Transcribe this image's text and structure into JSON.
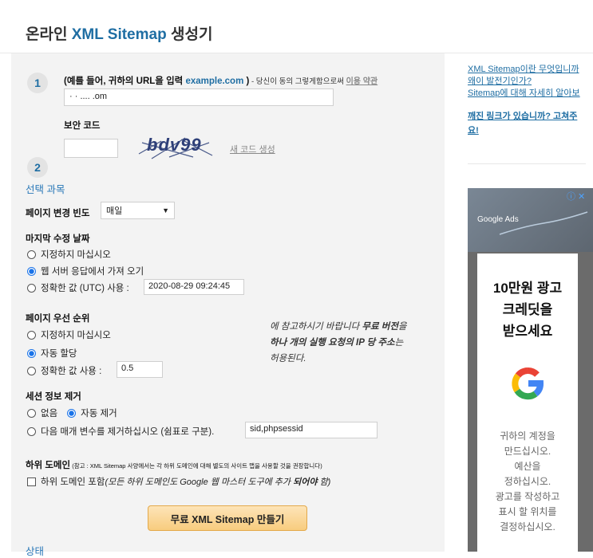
{
  "header": {
    "title_pre": "온라인 ",
    "title_accent": "XML Sitemap",
    "title_post": " 생성기"
  },
  "step1": {
    "number": "1",
    "label_main": "(예를 들어, 귀하의 URL을 입력 ",
    "label_example": "example.com",
    "label_close": " )",
    "label_small": " - 당신이 동의 그렇게함으로써 ",
    "terms_link": "이용 약관",
    "url_value": "·  ·      .... .om"
  },
  "step2": {
    "number": "2",
    "label": "보안 코드",
    "captcha_text": "bdv99",
    "new_code_link": "새 코드 생성"
  },
  "options": {
    "heading": "선택 과목",
    "freq_label": "페이지 변경 빈도",
    "freq_value": "매일",
    "lastmod": {
      "heading": "마지막 수정 날짜",
      "opt1": "지정하지 마십시오",
      "opt2": "웹 서버 응답에서 가져 오기",
      "opt3": "정확한 값 (UTC) 사용 :",
      "opt3_value": "2020-08-29 09:24:45"
    },
    "priority": {
      "heading": "페이지 우선 순위",
      "opt1": "지정하지 마십시오",
      "opt2": "자동 할당",
      "opt3": "정확한 값 사용 :",
      "opt3_value": "0.5"
    },
    "note": {
      "line1_pre": "에 참고하시기 바랍니다 ",
      "line1_bold": "무료 버전",
      "line1_post": "을",
      "line2_bold": "하나 개의 실행 요청의 IP 당 주소",
      "line2_post": "는",
      "line3": "허용된다."
    },
    "session": {
      "heading": "세션 정보 제거",
      "opt1": "없음",
      "opt2": "자동 제거",
      "opt3": "다음 매개 변수를 제거하십시오 (쉼표로 구분).",
      "opt3_value": "sid,phpsessid"
    },
    "subdomain": {
      "heading": "하위 도메인",
      "heading_note": " (참고 : XML Sitemap 사양에서는 각 하위 도메인에 대해 별도의 사이트 맵을 사용할 것을 권장합니다)",
      "check_label": "하위 도메인 포함",
      "check_note_pre": " (모든 하위 도메인도 Google 웹 마스터 도구에 추가 ",
      "check_note_bold": "되어야",
      "check_note_post": " 함)"
    },
    "submit": "무료 XML Sitemap 만들기",
    "cut_heading": "상태"
  },
  "sidebar": {
    "link1": "XML Sitemap이란 무엇입니까",
    "link2": "왜이 발전기인가?",
    "link3": "Sitemap에 대해 자세히 알아보",
    "link4_l1": "깨진 링크가 있습니까? 고쳐주",
    "link4_l2": "요!"
  },
  "ad": {
    "brand": "Google Ads",
    "adchoices": "ⓘ ✕",
    "headline_l1": "10만원 광고",
    "headline_l2": "크레딧을",
    "headline_l3": "받으세요",
    "body_l1": "귀하의 계정을",
    "body_l2": "만드십시오.",
    "body_l3": "예산을",
    "body_l4": "정하십시오.",
    "body_l5": "광고를 작성하고",
    "body_l6": "표시 할 위치를",
    "body_l7": "결정하십시오."
  },
  "colors": {
    "accent_blue": "#1f6ea3",
    "button_orange": "#f8cc7e",
    "panel_bg": "#f3f3f3"
  }
}
